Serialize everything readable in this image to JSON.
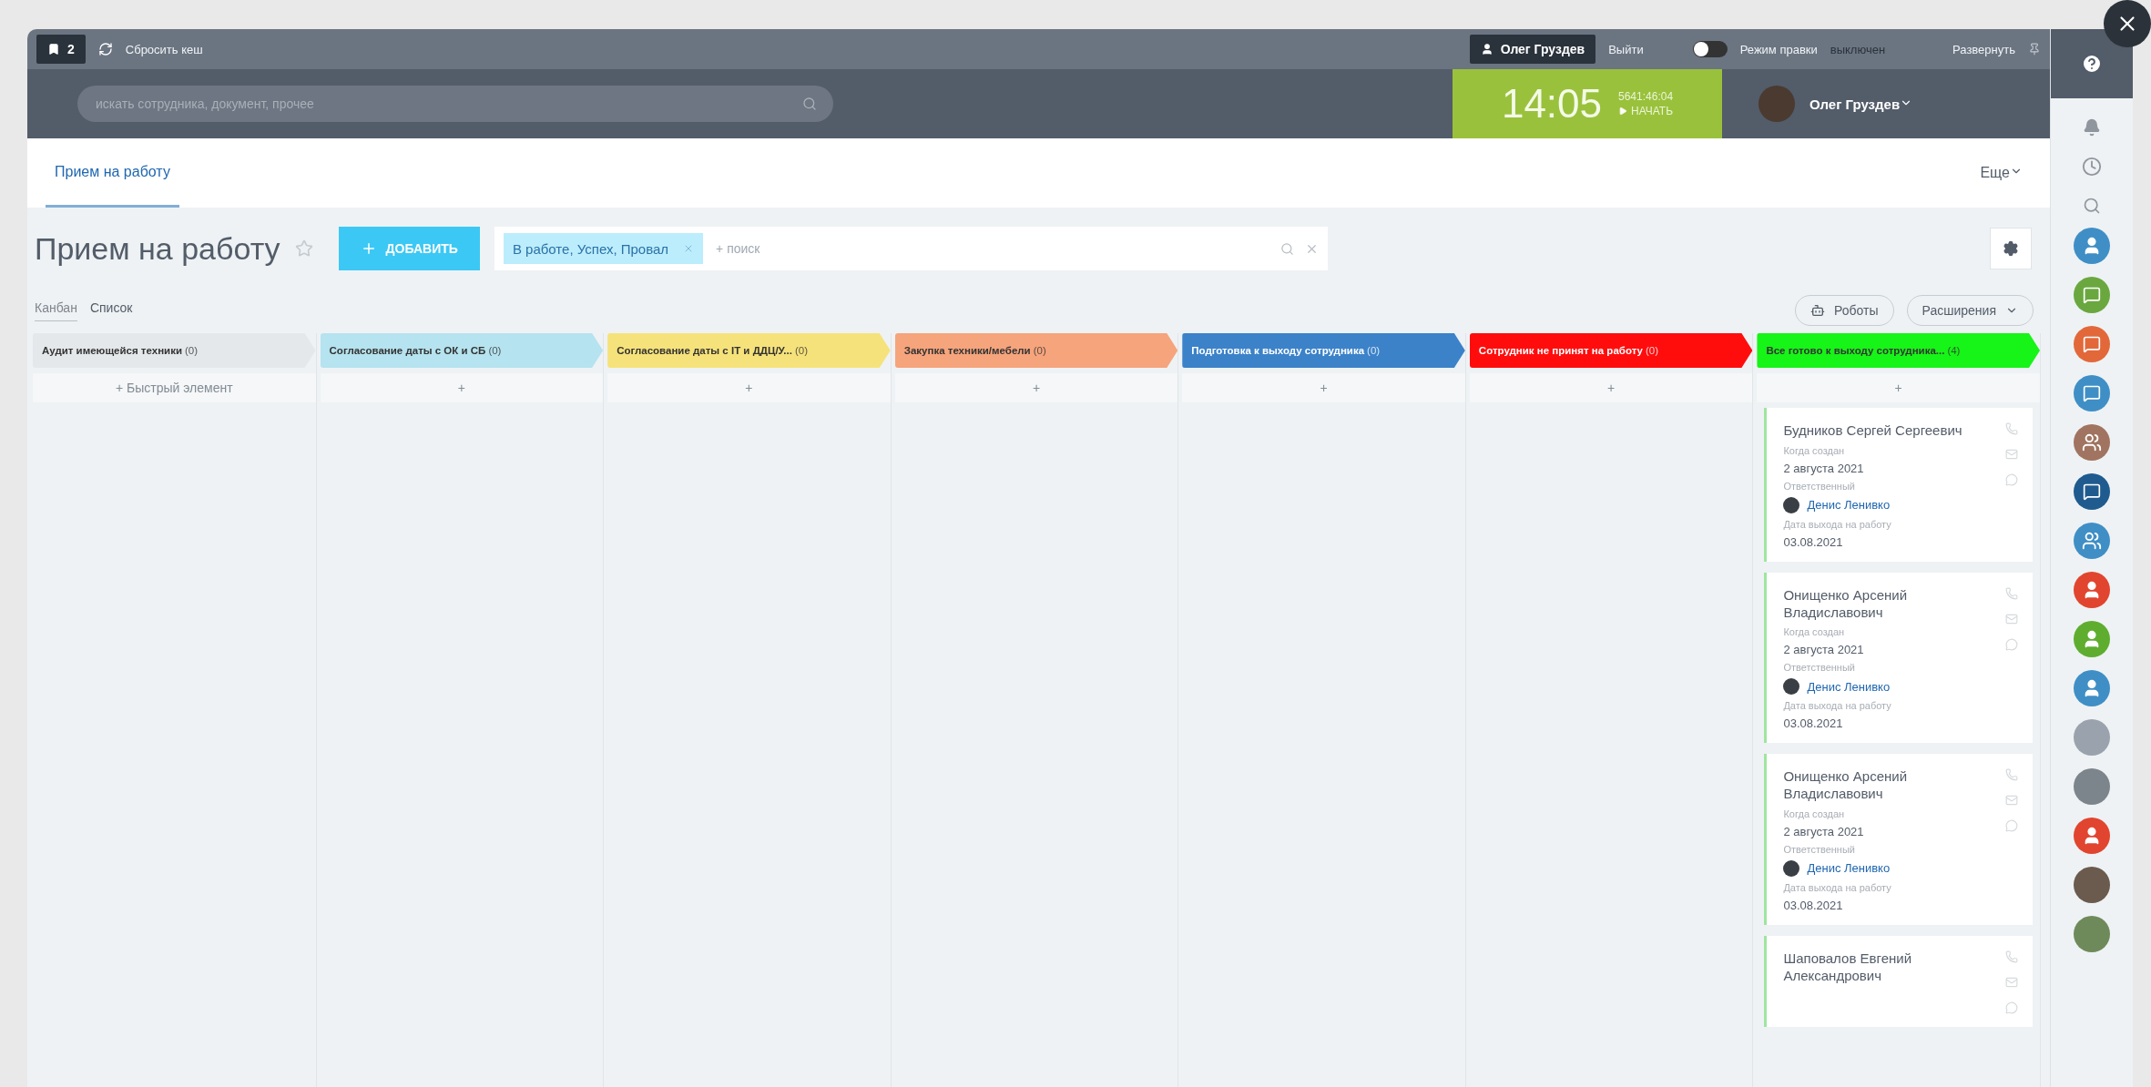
{
  "top_bar": {
    "counter": "2",
    "reset_cache": "Сбросить кеш",
    "user_button": "Олег Груздев",
    "logout": "Выйти",
    "edit_mode": {
      "label": "Режим правки",
      "state": "выключен",
      "on": false
    },
    "expand": "Развернуть"
  },
  "header": {
    "search": {
      "placeholder": "искать сотрудника, документ, прочее"
    },
    "clock": {
      "time": "14:05",
      "worked": "5641:46:04",
      "action": "НАЧАТЬ"
    },
    "user": {
      "name": "Олег Груздев"
    }
  },
  "tabs": [
    {
      "label": "Прием на работу",
      "selected": true
    }
  ],
  "more": "Еще",
  "toolbar": {
    "title": "Прием на работу",
    "add_button": "ДОБАВИТЬ",
    "filter_tag": "В работе, Успех, Провал",
    "filter_placeholder": "+ поиск"
  },
  "views": [
    {
      "label": "Канбан",
      "selected": true
    },
    {
      "label": "Список",
      "selected": false
    }
  ],
  "actions": {
    "robots": "Роботы",
    "extensions": "Расширения"
  },
  "columns": [
    {
      "title": "Аудит имеющейся техники",
      "count": "(0)",
      "color": "#e4e8eb",
      "add": "+ Быстрый элемент"
    },
    {
      "title": "Согласование даты с ОК и СБ",
      "count": "(0)",
      "color": "#b5e3ef",
      "add": "+"
    },
    {
      "title": "Согласование даты с IT и ДДЦ/У...",
      "count": "(0)",
      "color": "#f6e27a",
      "add": "+"
    },
    {
      "title": "Закупка техники/мебели",
      "count": "(0)",
      "color": "#f6a47c",
      "add": "+"
    },
    {
      "title": "Подготовка к выходу сотрудника",
      "count": "(0)",
      "color": "#3b82c9",
      "add": "+"
    },
    {
      "title": "Сотрудник не принят на работу",
      "count": "(0)",
      "color": "#ff0d0d",
      "add": "+"
    },
    {
      "title": "Все готово к выходу сотрудника...",
      "count": "(4)",
      "color": "#17f417",
      "add": "+",
      "cards": [
        {
          "name": "Будников Сергей Сергеевич",
          "fields": [
            {
              "label": "Когда создан",
              "value": "2 августа 2021",
              "kind": "text"
            },
            {
              "label": "Ответственный",
              "value": "Денис Ленивко",
              "kind": "user"
            },
            {
              "label": "Дата выхода на работу",
              "value": "03.08.2021",
              "kind": "text"
            }
          ]
        },
        {
          "name": "Онищенко Арсений Владиславович",
          "fields": [
            {
              "label": "Когда создан",
              "value": "2 августа 2021",
              "kind": "text"
            },
            {
              "label": "Ответственный",
              "value": "Денис Ленивко",
              "kind": "user"
            },
            {
              "label": "Дата выхода на работу",
              "value": "03.08.2021",
              "kind": "text"
            }
          ]
        },
        {
          "name": "Онищенко Арсений Владиславович",
          "fields": [
            {
              "label": "Когда создан",
              "value": "2 августа 2021",
              "kind": "text"
            },
            {
              "label": "Ответственный",
              "value": "Денис Ленивко",
              "kind": "user"
            },
            {
              "label": "Дата выхода на работу",
              "value": "03.08.2021",
              "kind": "text"
            }
          ]
        },
        {
          "name": "Шаповалов Евгений Александрович"
        }
      ]
    }
  ],
  "contacts": [
    {
      "kind": "user",
      "color": "#3f8fc6"
    },
    {
      "kind": "chat",
      "color": "#6aa83f"
    },
    {
      "kind": "chat",
      "color": "#e2683a"
    },
    {
      "kind": "chat",
      "color": "#3f8fc6"
    },
    {
      "kind": "group",
      "color": "#a07460"
    },
    {
      "kind": "chat",
      "color": "#1f5b8e"
    },
    {
      "kind": "group",
      "color": "#3f8fc6"
    },
    {
      "kind": "user",
      "color": "#e1452f"
    },
    {
      "kind": "user",
      "color": "#5fad2f"
    },
    {
      "kind": "user",
      "color": "#3f8fc6"
    },
    {
      "kind": "photo",
      "color": "#9aa3ad"
    },
    {
      "kind": "photo",
      "color": "#7d858c"
    },
    {
      "kind": "user",
      "color": "#e1452f"
    },
    {
      "kind": "photo",
      "color": "#6b5a4e"
    },
    {
      "kind": "photo",
      "color": "#6f8a5a"
    }
  ]
}
